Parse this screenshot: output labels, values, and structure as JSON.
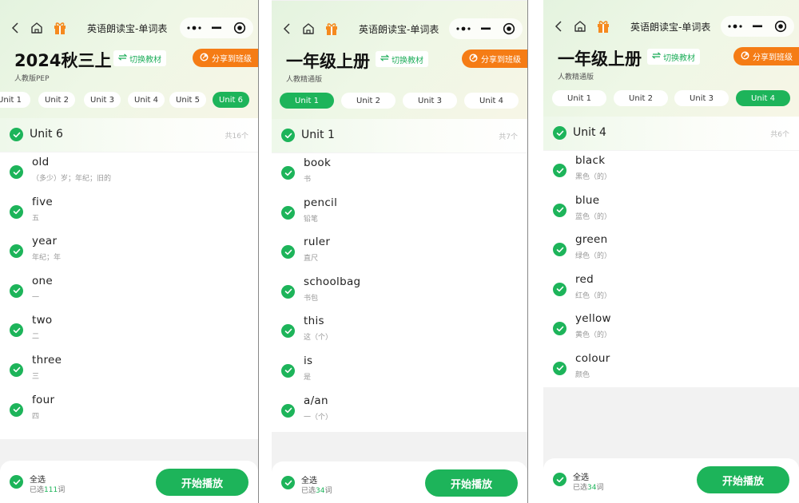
{
  "theme": {
    "accent": "#1db45a",
    "share_color": "#f57c15"
  },
  "panels": [
    {
      "nav_title": "英语朗读宝-单词表",
      "title": "2024秋三上",
      "switch_label": "切换教材",
      "share_label": "分享到班级",
      "subtitle": "人教版PEP",
      "tabs": [
        {
          "label": "Unit 1"
        },
        {
          "label": "Unit 2"
        },
        {
          "label": "Unit 3"
        },
        {
          "label": "Unit 4"
        },
        {
          "label": "Unit 5"
        },
        {
          "label": "Unit 6",
          "active": true
        }
      ],
      "unit": {
        "name": "Unit 6",
        "count": "共16个"
      },
      "words": [
        {
          "en": "old",
          "cn": "（多少）岁；年纪；旧的"
        },
        {
          "en": "five",
          "cn": "五"
        },
        {
          "en": "year",
          "cn": "年纪；年"
        },
        {
          "en": "one",
          "cn": "一"
        },
        {
          "en": "two",
          "cn": "二"
        },
        {
          "en": "three",
          "cn": "三"
        },
        {
          "en": "four",
          "cn": "四"
        }
      ],
      "select_all": "全选",
      "selected_prefix": "已选",
      "selected_count": "111",
      "selected_suffix": "词",
      "play_label": "开始播放"
    },
    {
      "nav_title": "英语朗读宝-单词表",
      "title": "一年级上册",
      "switch_label": "切换教材",
      "share_label": "分享到班级",
      "subtitle": "人教精通版",
      "tabs": [
        {
          "label": "Unit 1",
          "active": true
        },
        {
          "label": "Unit 2"
        },
        {
          "label": "Unit 3"
        },
        {
          "label": "Unit 4"
        }
      ],
      "unit": {
        "name": "Unit 1",
        "count": "共7个"
      },
      "words": [
        {
          "en": "book",
          "cn": "书"
        },
        {
          "en": "pencil",
          "cn": "铅笔"
        },
        {
          "en": "ruler",
          "cn": "直尺"
        },
        {
          "en": "schoolbag",
          "cn": "书包"
        },
        {
          "en": "this",
          "cn": "这（个）"
        },
        {
          "en": "is",
          "cn": "是"
        },
        {
          "en": "a/an",
          "cn": "一（个）"
        }
      ],
      "select_all": "全选",
      "selected_prefix": "已选",
      "selected_count": "34",
      "selected_suffix": "词",
      "play_label": "开始播放"
    },
    {
      "nav_title": "英语朗读宝-单词表",
      "title": "一年级上册",
      "switch_label": "切换教材",
      "share_label": "分享到班级",
      "subtitle": "人教精通版",
      "tabs": [
        {
          "label": "Unit 1"
        },
        {
          "label": "Unit 2"
        },
        {
          "label": "Unit 3"
        },
        {
          "label": "Unit 4",
          "active": true
        }
      ],
      "unit": {
        "name": "Unit 4",
        "count": "共6个"
      },
      "words": [
        {
          "en": "black",
          "cn": "黑色（的）"
        },
        {
          "en": "blue",
          "cn": "蓝色（的）"
        },
        {
          "en": "green",
          "cn": "绿色（的）"
        },
        {
          "en": "red",
          "cn": "红色（的）"
        },
        {
          "en": "yellow",
          "cn": "黄色（的）"
        },
        {
          "en": "colour",
          "cn": "颜色"
        }
      ],
      "select_all": "全选",
      "selected_prefix": "已选",
      "selected_count": "34",
      "selected_suffix": "词",
      "play_label": "开始播放"
    }
  ]
}
